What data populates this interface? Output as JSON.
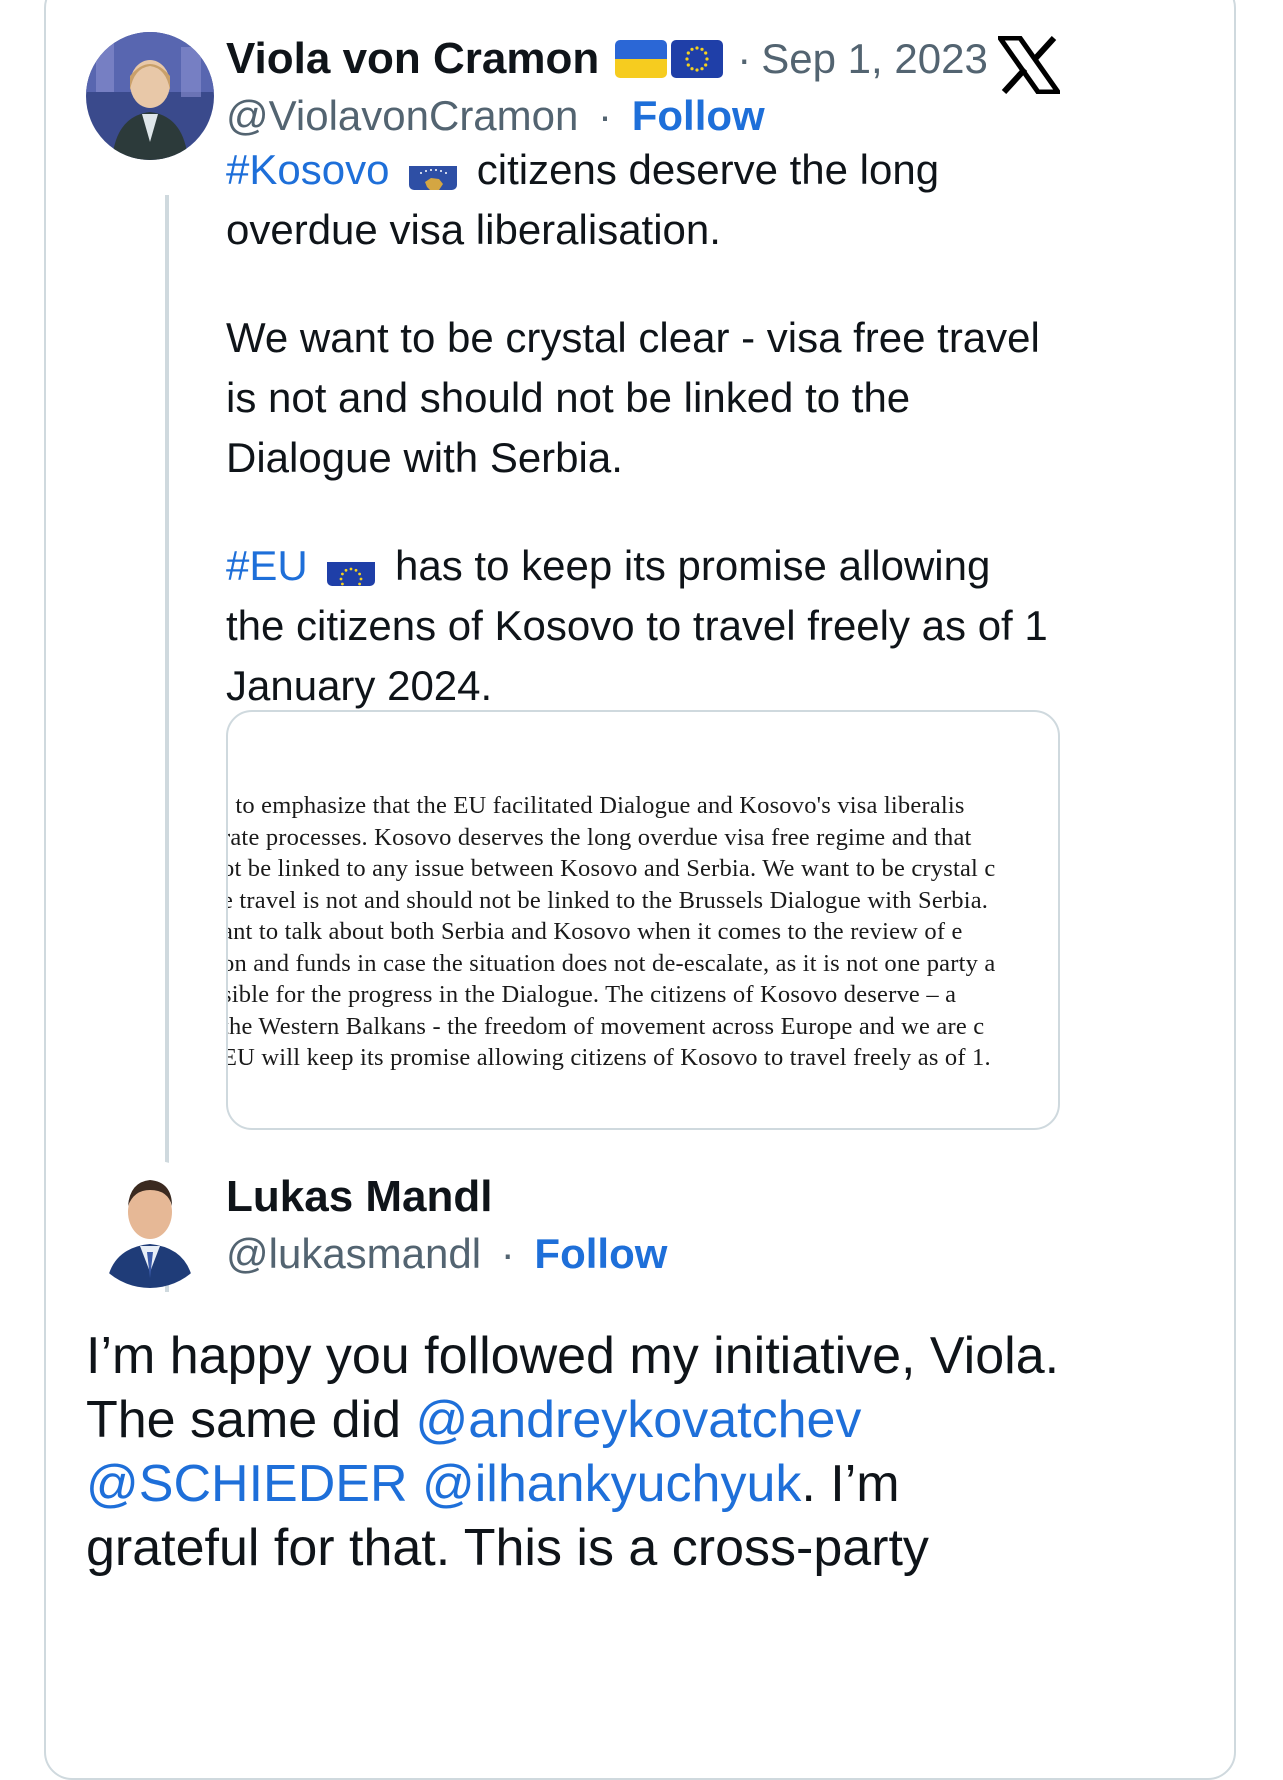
{
  "tweet": {
    "author_name": "Viola von Cramon",
    "author_flags": [
      "ukraine-flag-icon",
      "eu-flag-icon"
    ],
    "date_sep": "·",
    "date": "Sep 1, 2023",
    "handle": "@ViolavonCramon",
    "follow_sep": "·",
    "follow_label": "Follow",
    "text": {
      "p1_hashtag": "#Kosovo",
      "p1_rest": " citizens deserve the long overdue visa liberalisation.",
      "p2": "We want to be crystal clear - visa free travel is not and should not be linked to the Dialogue with Serbia.",
      "p3_hashtag": "#EU",
      "p3_rest": " has to keep its promise allowing the citizens of Kosovo to travel freely as of 1 January 2024."
    },
    "media_lines": [
      "; to emphasize that the EU facilitated Dialogue and Kosovo's visa liberalis",
      "rate processes. Kosovo deserves the long overdue visa free regime and that",
      "ot be linked to any issue between Kosovo and Serbia. We want to be crystal c",
      "e travel is not and should not be linked to the Brussels Dialogue with Serbia.",
      "ant to talk about both Serbia and Kosovo when it comes to the review of e",
      "on and funds in case the situation does not de-escalate, as it is not one party a",
      "sible for the progress in the Dialogue. The citizens of Kosovo deserve – a",
      "the Western Balkans - the freedom of movement across Europe and we are c",
      "EU will keep its promise allowing citizens of Kosovo to travel freely as of 1."
    ]
  },
  "reply": {
    "author_name": "Lukas Mandl",
    "handle": "@lukasmandl",
    "follow_sep": "·",
    "follow_label": "Follow",
    "text_start": "I’m happy you followed my initiative, Viola. The same did ",
    "mention1": "@andreykovatchev",
    "mention2": "@SCHIEDER",
    "mention3": "@ilhankyuchyuk",
    "text_end": ". I’m grateful for that. This is a cross-party"
  },
  "colors": {
    "link": "#1e6fd9",
    "muted": "#536471",
    "border": "#cfd9de"
  }
}
